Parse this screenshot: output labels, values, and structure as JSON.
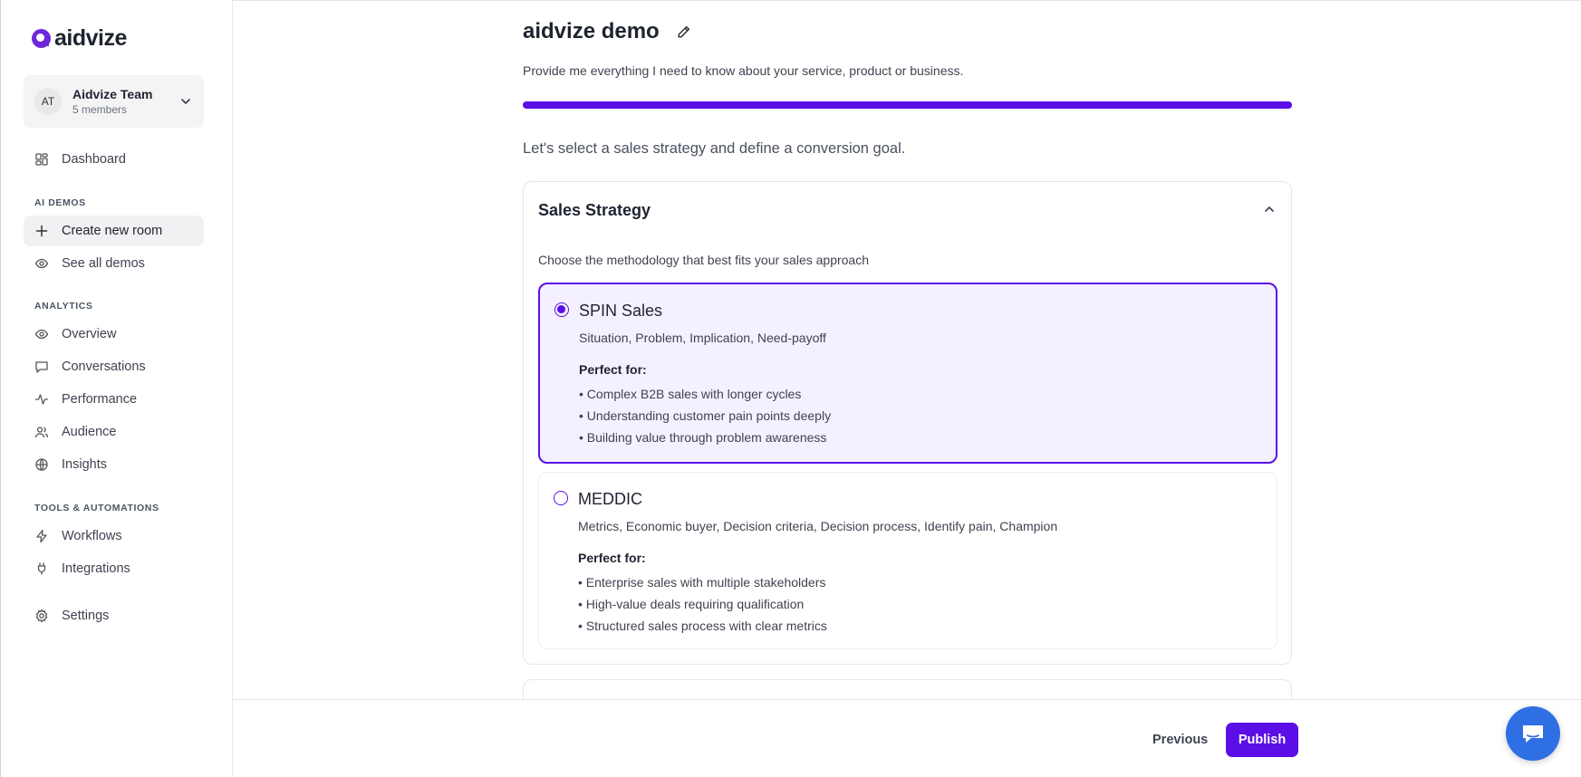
{
  "brand": {
    "name": "aidvize",
    "accent": "#5b0fe6"
  },
  "team": {
    "initials": "AT",
    "name": "Aidvize Team",
    "members": "5 members"
  },
  "sidebar": {
    "dashboard": "Dashboard",
    "sections": {
      "ai_demos": "AI DEMOS",
      "analytics": "ANALYTICS",
      "tools": "TOOLS & AUTOMATIONS"
    },
    "ai_demos": [
      {
        "label": "Create new room",
        "icon": "plus-icon"
      },
      {
        "label": "See all demos",
        "icon": "eye-icon"
      }
    ],
    "analytics": [
      {
        "label": "Overview",
        "icon": "eye-icon"
      },
      {
        "label": "Conversations",
        "icon": "chat-icon"
      },
      {
        "label": "Performance",
        "icon": "activity-icon"
      },
      {
        "label": "Audience",
        "icon": "users-icon"
      },
      {
        "label": "Insights",
        "icon": "globe-icon"
      }
    ],
    "tools": [
      {
        "label": "Workflows",
        "icon": "lightning-icon"
      },
      {
        "label": "Integrations",
        "icon": "plug-icon"
      }
    ],
    "settings": "Settings"
  },
  "main": {
    "title": "aidvize demo",
    "subtitle": "Provide me everything I need to know about your service, product or business.",
    "progress": 1.0,
    "step_text": "Let's select a sales strategy and define a conversion goal.",
    "card": {
      "title": "Sales Strategy",
      "description": "Choose the methodology that best fits your sales approach",
      "perfect_for_label": "Perfect for:",
      "options": [
        {
          "name": "SPIN Sales",
          "description": "Situation, Problem, Implication, Need-payoff",
          "selected": true,
          "bullets": [
            "• Complex B2B sales with longer cycles",
            "• Understanding customer pain points deeply",
            "• Building value through problem awareness"
          ]
        },
        {
          "name": "MEDDIC",
          "description": "Metrics, Economic buyer, Decision criteria, Decision process, Identify pain, Champion",
          "selected": false,
          "bullets": [
            "• Enterprise sales with multiple stakeholders",
            "• High-value deals requiring qualification",
            "• Structured sales process with clear metrics"
          ]
        }
      ]
    }
  },
  "footer": {
    "previous": "Previous",
    "publish": "Publish"
  }
}
